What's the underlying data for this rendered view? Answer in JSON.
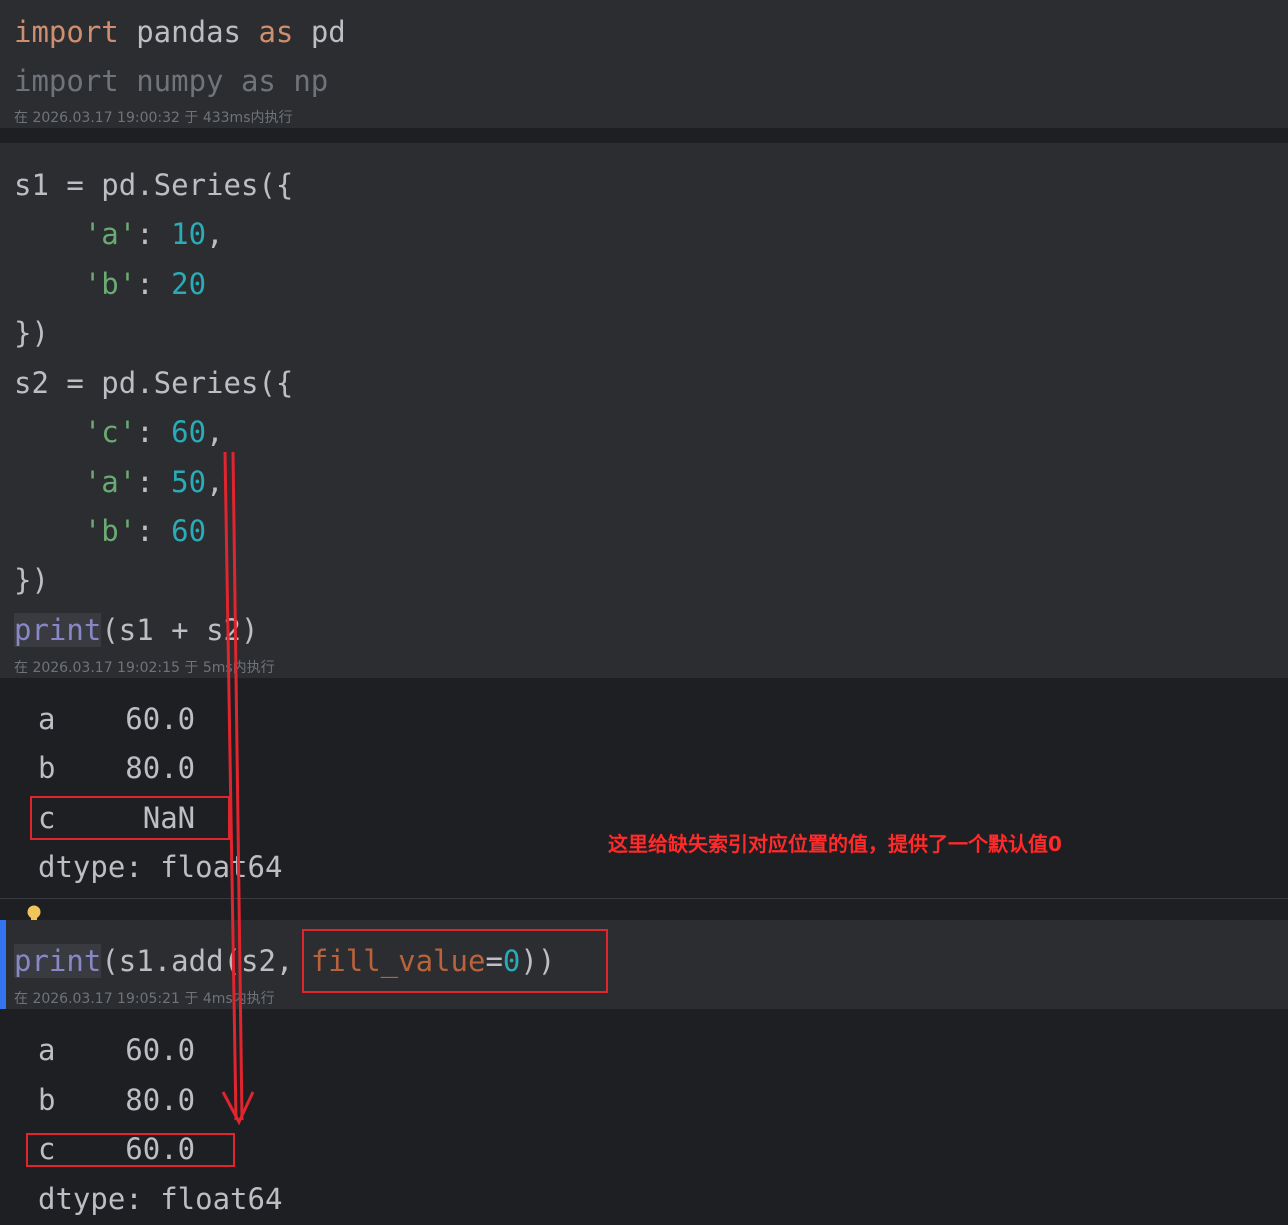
{
  "cells": [
    {
      "code": {
        "l1": {
          "kw1": "import",
          "mod": " pandas ",
          "kw2": "as",
          "alias": " pd"
        },
        "l2": "import numpy as np"
      },
      "meta": "在 2026.03.17 19:00:32 于 433ms内执行"
    },
    {
      "code": {
        "l1": "s1 = pd.Series({",
        "l2": {
          "key": "'a'",
          "colon": ": ",
          "val": "10",
          "end": ","
        },
        "l3": {
          "key": "'b'",
          "colon": ": ",
          "val": "20"
        },
        "l4": "})",
        "l5": "s2 = pd.Series({",
        "l6": {
          "key": "'c'",
          "colon": ": ",
          "val": "60",
          "end": ","
        },
        "l7": {
          "key": "'a'",
          "colon": ": ",
          "val": "50",
          "end": ","
        },
        "l8": {
          "key": "'b'",
          "colon": ": ",
          "val": "60"
        },
        "l9": "})",
        "l10": {
          "fn": "print",
          "args": "(s1 + s2)"
        }
      },
      "meta": "在 2026.03.17 19:02:15 于 5ms内执行",
      "output": [
        "a    60.0",
        "b    80.0",
        "c     NaN",
        "dtype: float64"
      ]
    },
    {
      "code": {
        "fn": "print",
        "args1": "(s1.add(s2, ",
        "param": "fill_value",
        "eq": "=",
        "val": "0",
        "end": "))"
      },
      "meta": "在 2026.03.17 19:05:21 于 4ms内执行",
      "output": [
        "a    60.0",
        "b    80.0",
        "c    60.0",
        "dtype: float64"
      ]
    }
  ],
  "annotation": "这里给缺失索引对应位置的值，提供了一个默认值0",
  "colors": {
    "annotation": "#e0252f",
    "keyword": "#cf8e6d",
    "string": "#6aab73",
    "number": "#2aacb8",
    "builtin": "#8888c6"
  },
  "icons": [
    "lightbulb-icon",
    "red-arrow"
  ]
}
